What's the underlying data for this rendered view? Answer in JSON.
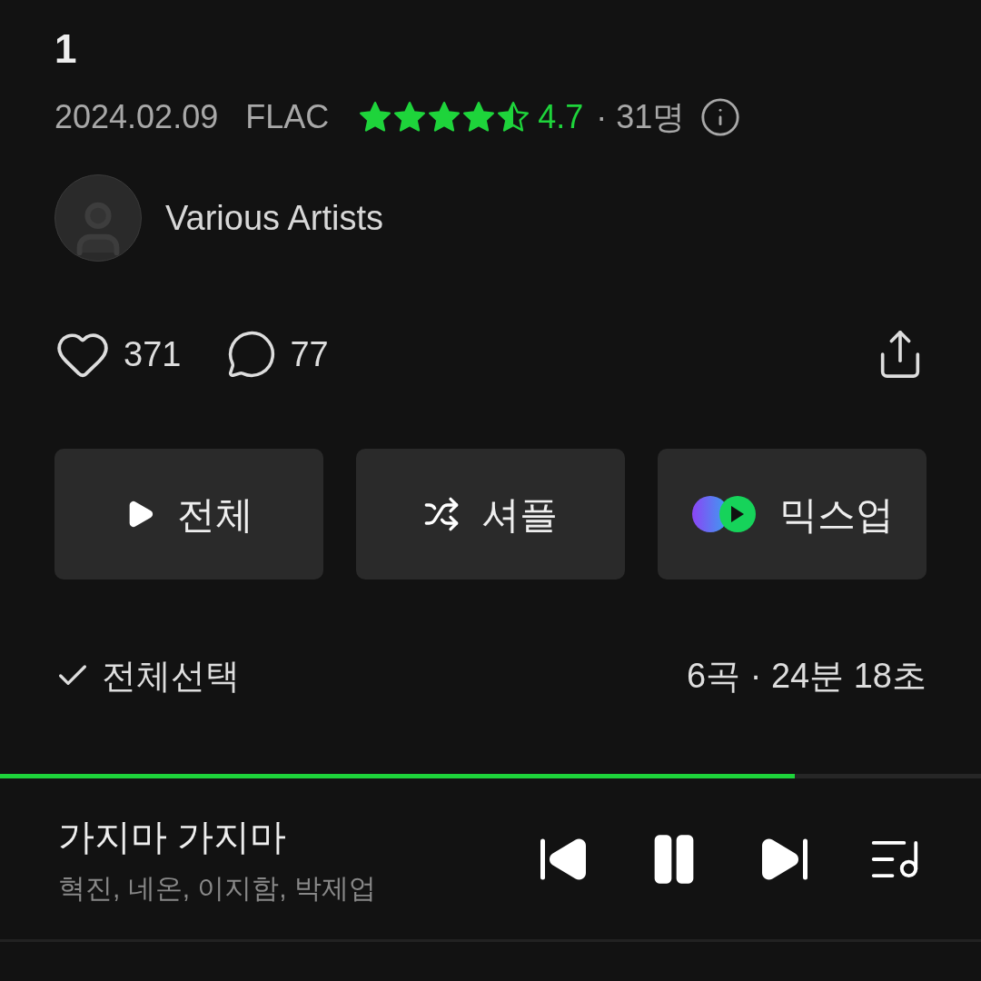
{
  "album": {
    "title": "1",
    "date": "2024.02.09",
    "format": "FLAC",
    "stars": 4.5,
    "rating": "4.7",
    "raters": "· 31명",
    "artist": "Various Artists"
  },
  "stats": {
    "likes": "371",
    "comments": "77"
  },
  "actions": [
    {
      "kind": "play",
      "label": "전체"
    },
    {
      "kind": "shuffle",
      "label": "셔플"
    },
    {
      "kind": "mixup",
      "label": "믹스업"
    }
  ],
  "list_header": {
    "select_all": "전체선택",
    "summary": "6곡 · 24분 18초"
  },
  "player": {
    "level": 0.81,
    "title": "가지마 가지마",
    "artists": "혁진, 네온, 이지함, 박제업",
    "playing": true
  }
}
